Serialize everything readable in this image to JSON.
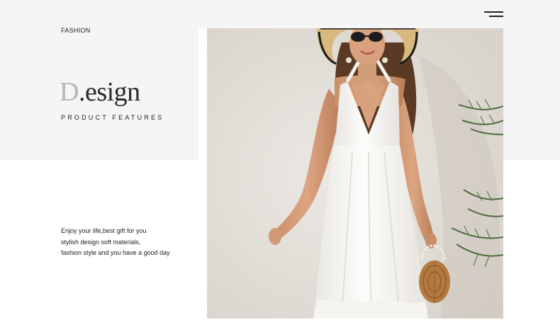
{
  "header": {
    "eyebrow": "FASHION",
    "menu_icon": "hamburger-menu-icon"
  },
  "hero": {
    "title_initial": "D",
    "title_rest": ".esign",
    "subtitle": "PRODUCT FEATURES"
  },
  "description": {
    "lines": [
      "Enjoy your life,best gift for you",
      "stylish design soft materials,",
      "fashion style and you have a good day"
    ]
  },
  "photo": {
    "subject": "model-in-white-halter-maxi-dress"
  },
  "colors": {
    "band": "#f5f5f5",
    "text": "#222222",
    "title_initial": "#b6b6b6",
    "dress": "#fbfaf8"
  }
}
